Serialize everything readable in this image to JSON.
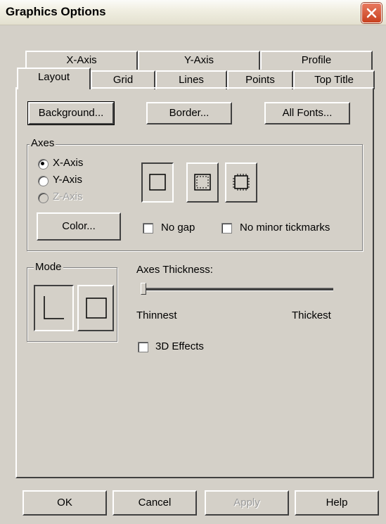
{
  "window": {
    "title": "Graphics Options"
  },
  "tabs": {
    "row_back": [
      "X-Axis",
      "Y-Axis",
      "Profile"
    ],
    "row_front": [
      "Layout",
      "Grid",
      "Lines",
      "Points",
      "Top Title"
    ],
    "active": "Layout"
  },
  "buttons": {
    "background": "Background...",
    "border": "Border...",
    "all_fonts": "All Fonts..."
  },
  "axes_group": {
    "label": "Axes",
    "radios": [
      {
        "label": "X-Axis",
        "checked": true,
        "disabled": false
      },
      {
        "label": "Y-Axis",
        "checked": false,
        "disabled": false
      },
      {
        "label": "Z-Axis",
        "checked": false,
        "disabled": true
      }
    ],
    "color_button": "Color...",
    "no_gap": "No gap",
    "no_minor_tickmarks": "No minor tickmarks"
  },
  "mode_group": {
    "label": "Mode"
  },
  "thickness": {
    "label": "Axes Thickness:",
    "min_label": "Thinnest",
    "max_label": "Thickest",
    "value": 0
  },
  "effects_3d": "3D Effects",
  "footer": {
    "ok": "OK",
    "cancel": "Cancel",
    "apply": "Apply",
    "help": "Help"
  }
}
